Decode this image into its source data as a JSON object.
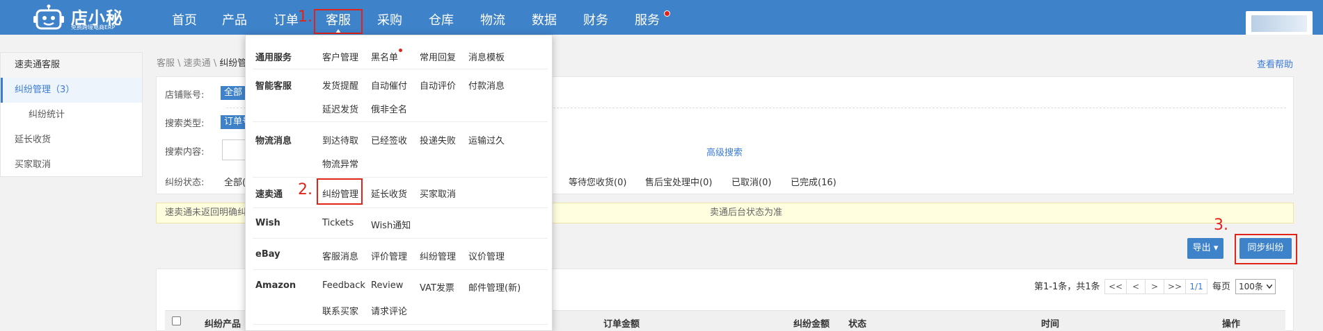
{
  "brand": {
    "name": "店小秘",
    "slogan": "免费跨境电商ERP"
  },
  "nav": {
    "items": [
      {
        "label": "首页"
      },
      {
        "label": "产品"
      },
      {
        "label": "订单"
      },
      {
        "label": "客服"
      },
      {
        "label": "采购"
      },
      {
        "label": "仓库"
      },
      {
        "label": "物流"
      },
      {
        "label": "数据"
      },
      {
        "label": "财务"
      },
      {
        "label": "服务"
      }
    ],
    "active": "客服"
  },
  "annotations": {
    "step1": "1.",
    "step2": "2.",
    "step3": "3."
  },
  "sidebar": {
    "title": "速卖通客服",
    "items": [
      {
        "label": "纠纷管理（3）"
      },
      {
        "label": "纠纷统计"
      },
      {
        "label": "延长收货"
      },
      {
        "label": "买家取消"
      }
    ]
  },
  "breadcrumb": {
    "a": "客服",
    "sep1": " \\ ",
    "b": "速卖通",
    "sep2": " \\ ",
    "c": "纠纷管"
  },
  "help_link": "查看帮助",
  "filters": {
    "shop_label": "店铺账号:",
    "shop_value": "全部",
    "search_type_label": "搜索类型:",
    "search_type_value": "订单号",
    "search_content_label": "搜索内容:",
    "advanced_search": "高级搜索",
    "dispute_status_label": "纠纷状态:",
    "status_all": "全部(",
    "statuses": [
      "等待您收货(0)",
      "售后宝处理中(0)",
      "已取消(0)",
      "已完成(16)"
    ]
  },
  "notice": {
    "left": "速卖通未返回明确纠",
    "right": "卖通后台状态为准"
  },
  "actions": {
    "export": "导出",
    "export_caret": "▾",
    "sync": "同步纠纷"
  },
  "pager": {
    "summary": "第1-1条，共1条",
    "first": "<<",
    "prev": "<",
    "next": ">",
    "last": ">>",
    "page": "1/1",
    "per_page_label": "每页",
    "per_page_value": "100条"
  },
  "table": {
    "headers": [
      "纠纷产品",
      "订单金额",
      "纠纷金额",
      "状态",
      "时间",
      "操作"
    ]
  },
  "dropdown": {
    "groups": [
      {
        "category": "通用服务",
        "items": [
          "客户管理",
          "黑名单",
          "常用回复",
          "消息模板"
        ]
      },
      {
        "category": "智能客服",
        "items": [
          "发货提醒",
          "自动催付",
          "自动评价",
          "付款消息",
          "延迟发货",
          "俄非全名"
        ]
      },
      {
        "category": "物流消息",
        "items": [
          "到达待取",
          "已经签收",
          "投递失败",
          "运输过久",
          "物流异常"
        ]
      },
      {
        "category": "速卖通",
        "items": [
          "纠纷管理",
          "延长收货",
          "买家取消"
        ]
      },
      {
        "category": "Wish",
        "items": [
          "Tickets",
          "Wish通知"
        ]
      },
      {
        "category": "eBay",
        "items": [
          "客服消息",
          "评价管理",
          "纠纷管理",
          "议价管理"
        ]
      },
      {
        "category": "Amazon",
        "items": [
          "Feedback",
          "Review",
          "VAT发票",
          "邮件管理(新)",
          "联系买家",
          "请求评论"
        ]
      }
    ]
  },
  "colors": {
    "nav_bg": "#3e82c9",
    "accent": "#3a7bd5",
    "highlight_red": "#e0241a",
    "notice_bg": "#ffffe0"
  }
}
